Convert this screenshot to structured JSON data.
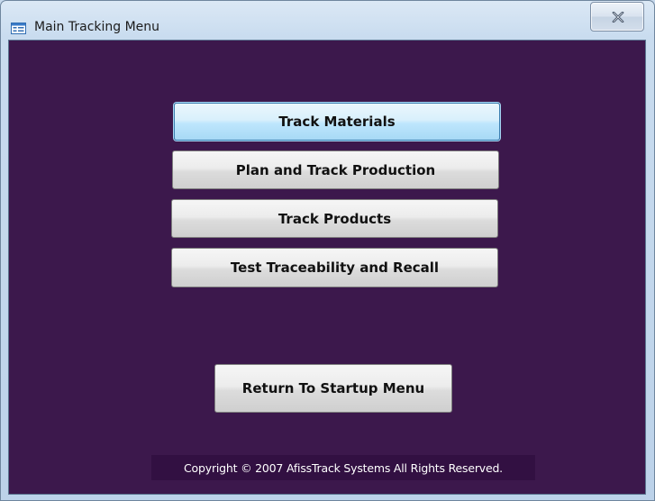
{
  "window": {
    "title": "Main Tracking Menu",
    "app_icon": "form-icon",
    "close_icon": "close-icon"
  },
  "menu": {
    "track_materials": "Track Materials",
    "plan_production": "Plan and Track Production",
    "track_products": "Track Products",
    "test_traceability": "Test Traceability and Recall",
    "return_startup": "Return To Startup Menu"
  },
  "footer": {
    "copyright": "Copyright © 2007 AfissTrack Systems All Rights Reserved."
  },
  "colors": {
    "background": "#3c184c",
    "copyright_bg": "#321042",
    "focused_button": "#bee6fd"
  }
}
